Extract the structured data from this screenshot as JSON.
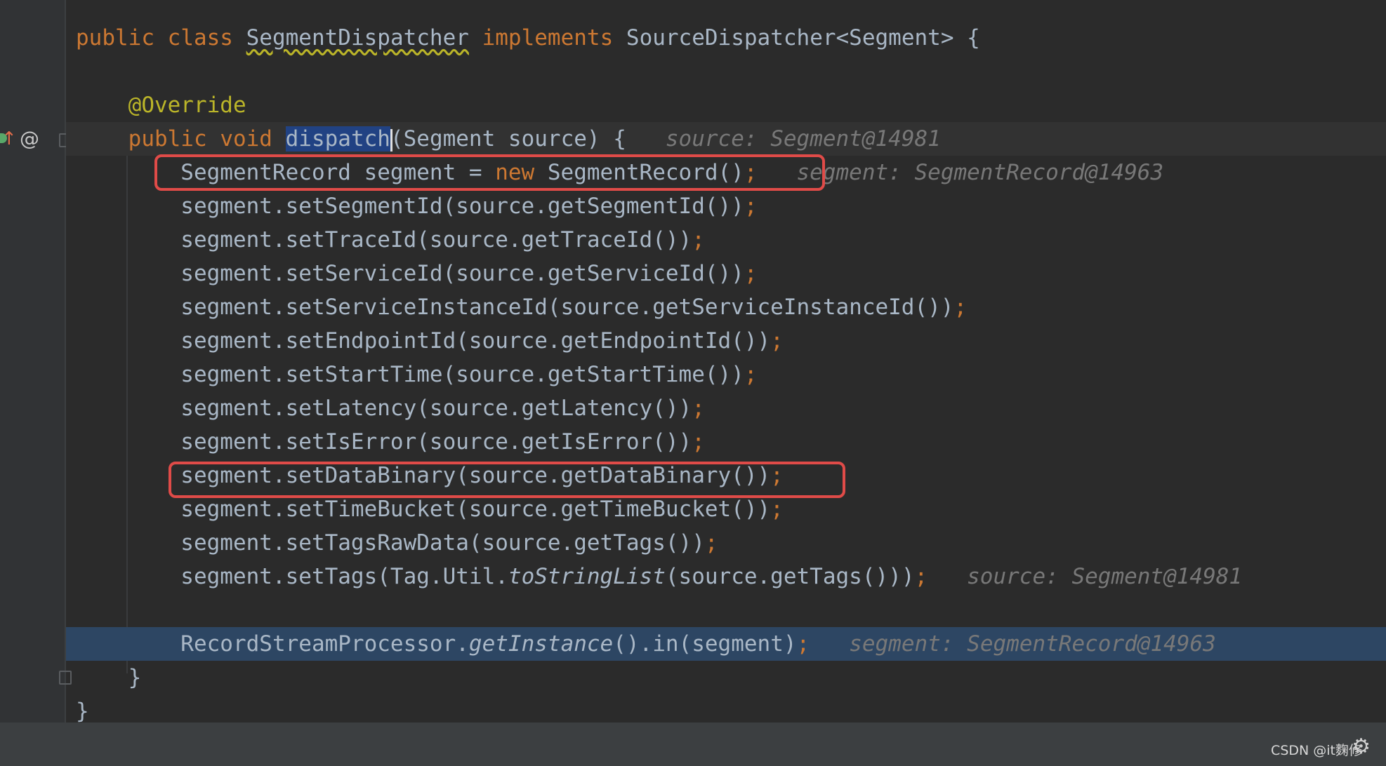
{
  "editor": {
    "lines": [
      [
        {
          "t": "public ",
          "c": "kw"
        },
        {
          "t": "class ",
          "c": "kw"
        },
        {
          "t": "SegmentDispatcher",
          "c": "squig"
        },
        {
          "t": " ",
          "c": ""
        },
        {
          "t": "implements ",
          "c": "kw"
        },
        {
          "t": "SourceDispatcher<Segment> {",
          "c": ""
        }
      ],
      [],
      [
        {
          "t": "    ",
          "c": ""
        },
        {
          "t": "@Override",
          "c": "ann"
        }
      ],
      [
        {
          "t": "    ",
          "c": ""
        },
        {
          "t": "public ",
          "c": "kw"
        },
        {
          "t": "void ",
          "c": "kw"
        },
        {
          "t": "dispatch",
          "c": "sel"
        },
        {
          "t": "",
          "c": "caret"
        },
        {
          "t": "(Segment source) {",
          "c": ""
        },
        {
          "t": "   source: Segment@14981",
          "c": "hint"
        }
      ],
      [
        {
          "t": "        SegmentRecord segment = ",
          "c": ""
        },
        {
          "t": "new ",
          "c": "kw"
        },
        {
          "t": "SegmentRecord()",
          "c": ""
        },
        {
          "t": ";",
          "c": "punc"
        },
        {
          "t": "   segment: SegmentRecord@14963",
          "c": "hint"
        }
      ],
      [
        {
          "t": "        segment.setSegmentId(source.getSegmentId())",
          "c": ""
        },
        {
          "t": ";",
          "c": "punc"
        }
      ],
      [
        {
          "t": "        segment.setTraceId(source.getTraceId())",
          "c": ""
        },
        {
          "t": ";",
          "c": "punc"
        }
      ],
      [
        {
          "t": "        segment.setServiceId(source.getServiceId())",
          "c": ""
        },
        {
          "t": ";",
          "c": "punc"
        }
      ],
      [
        {
          "t": "        segment.setServiceInstanceId(source.getServiceInstanceId())",
          "c": ""
        },
        {
          "t": ";",
          "c": "punc"
        }
      ],
      [
        {
          "t": "        segment.setEndpointId(source.getEndpointId())",
          "c": ""
        },
        {
          "t": ";",
          "c": "punc"
        }
      ],
      [
        {
          "t": "        segment.setStartTime(source.getStartTime())",
          "c": ""
        },
        {
          "t": ";",
          "c": "punc"
        }
      ],
      [
        {
          "t": "        segment.setLatency(source.getLatency())",
          "c": ""
        },
        {
          "t": ";",
          "c": "punc"
        }
      ],
      [
        {
          "t": "        segment.setIsError(source.getIsError())",
          "c": ""
        },
        {
          "t": ";",
          "c": "punc"
        }
      ],
      [
        {
          "t": "        segment.setDataBinary(source.getDataBinary())",
          "c": ""
        },
        {
          "t": ";",
          "c": "punc"
        }
      ],
      [
        {
          "t": "        segment.setTimeBucket(source.getTimeBucket())",
          "c": ""
        },
        {
          "t": ";",
          "c": "punc"
        }
      ],
      [
        {
          "t": "        segment.setTagsRawData(source.getTags())",
          "c": ""
        },
        {
          "t": ";",
          "c": "punc"
        }
      ],
      [
        {
          "t": "        segment.setTags(Tag.Util.",
          "c": ""
        },
        {
          "t": "toStringList",
          "c": "it"
        },
        {
          "t": "(source.getTags()))",
          "c": ""
        },
        {
          "t": ";",
          "c": "punc"
        },
        {
          "t": "   source: Segment@14981",
          "c": "hint"
        }
      ],
      [],
      [
        {
          "t": "        RecordStreamProcessor.",
          "c": ""
        },
        {
          "t": "getInstance",
          "c": "it"
        },
        {
          "t": "().in(segment)",
          "c": ""
        },
        {
          "t": ";",
          "c": "punc"
        },
        {
          "t": "   segment: SegmentRecord@14963",
          "c": "hint"
        }
      ],
      [
        {
          "t": "    }",
          "c": ""
        }
      ],
      [
        {
          "t": "}",
          "c": ""
        }
      ]
    ],
    "current_line": 3,
    "execution_line": 18
  },
  "gutter": {
    "override_icon": "@",
    "impl_icon": "↑"
  },
  "statusbar": {
    "watermark": "CSDN @it麴修"
  },
  "colors": {
    "background": "#2b2b2b",
    "keyword": "#cc7832",
    "annotation": "#bbb529",
    "text": "#a9b7c6",
    "hint": "#787878",
    "highlight_box": "#e04b48",
    "execution_line": "#2d4663"
  }
}
